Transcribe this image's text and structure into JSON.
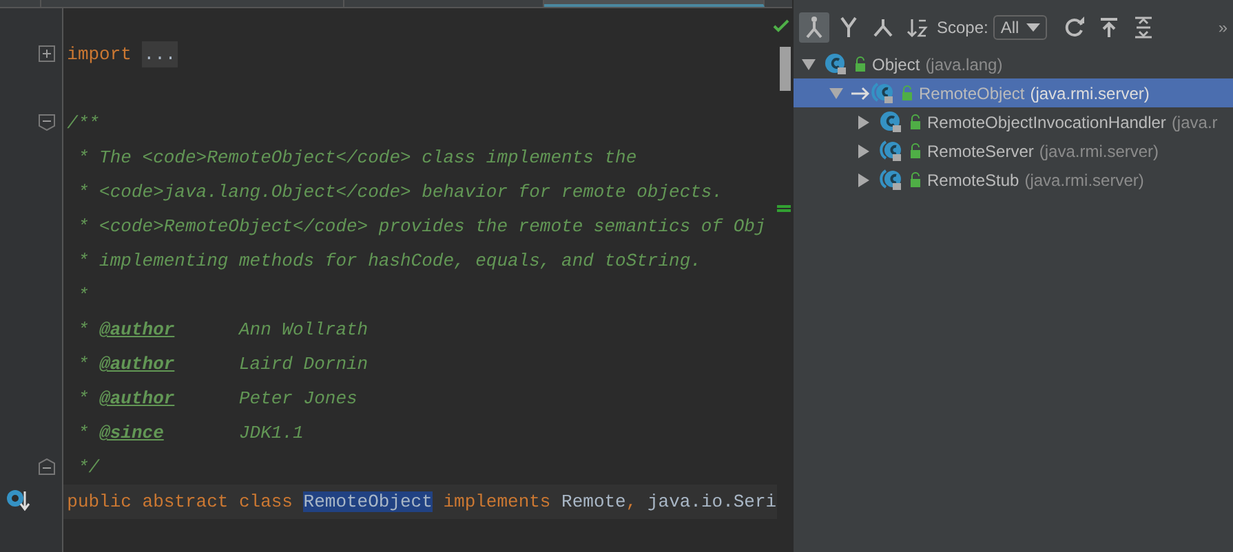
{
  "editor": {
    "lines": [
      {
        "fold_collapsed": true,
        "tokens": [
          {
            "kind": "keyword",
            "text": "import"
          },
          {
            "kind": "folded",
            "text": "..."
          }
        ]
      },
      {
        "kind": "blank"
      },
      {
        "fold_start": true,
        "tokens": [
          {
            "kind": "comment",
            "text": "/**"
          }
        ]
      },
      {
        "tokens": [
          {
            "kind": "comment",
            "text": " * The <code>RemoteObject</code> class implements the"
          }
        ]
      },
      {
        "tokens": [
          {
            "kind": "comment",
            "text": " * <code>java.lang.Object</code> behavior for remote objects."
          }
        ]
      },
      {
        "tokens": [
          {
            "kind": "comment",
            "text": " * <code>RemoteObject</code> provides the remote semantics of Obj"
          }
        ]
      },
      {
        "tokens": [
          {
            "kind": "comment",
            "text": " * implementing methods for hashCode, equals, and toString."
          }
        ]
      },
      {
        "tokens": [
          {
            "kind": "comment",
            "text": " *"
          }
        ]
      },
      {
        "tokens": [
          {
            "kind": "comment",
            "text": " * "
          },
          {
            "kind": "doctag",
            "text": "@author"
          },
          {
            "kind": "comment",
            "text": "      Ann Wollrath"
          }
        ]
      },
      {
        "tokens": [
          {
            "kind": "comment",
            "text": " * "
          },
          {
            "kind": "doctag",
            "text": "@author"
          },
          {
            "kind": "comment",
            "text": "      Laird Dornin"
          }
        ]
      },
      {
        "tokens": [
          {
            "kind": "comment",
            "text": " * "
          },
          {
            "kind": "doctag",
            "text": "@author"
          },
          {
            "kind": "comment",
            "text": "      Peter Jones"
          }
        ]
      },
      {
        "tokens": [
          {
            "kind": "comment",
            "text": " * "
          },
          {
            "kind": "doctag",
            "text": "@since"
          },
          {
            "kind": "comment",
            "text": "       JDK1.1"
          }
        ]
      },
      {
        "fold_end": true,
        "tokens": [
          {
            "kind": "comment",
            "text": " */"
          }
        ]
      },
      {
        "current": true,
        "marker": true,
        "tokens": [
          {
            "kind": "keyword",
            "text": "public abstract class "
          },
          {
            "kind": "selected",
            "text": "RemoteObject"
          },
          {
            "kind": "keyword",
            "text": " implements "
          },
          {
            "kind": "plain",
            "text": "Remote"
          },
          {
            "kind": "keyword",
            "text": ","
          },
          {
            "kind": "plain",
            "text": " java.io.Seri"
          }
        ]
      }
    ]
  },
  "hierarchy": {
    "toolbar": {
      "scope_label": "Scope:",
      "scope_value": "All",
      "overflow": "»"
    },
    "tree": [
      {
        "name": "Object",
        "package": "(java.lang)",
        "kind": "class",
        "expanded": true,
        "selected": false,
        "children": [
          {
            "name": "RemoteObject",
            "package": "(java.rmi.server)",
            "kind": "abstract",
            "expanded": true,
            "selected": true,
            "children": [
              {
                "name": "RemoteObjectInvocationHandler",
                "package": "(java.r",
                "kind": "class",
                "expanded": false,
                "selected": false
              },
              {
                "name": "RemoteServer",
                "package": "(java.rmi.server)",
                "kind": "abstract",
                "expanded": false,
                "selected": false
              },
              {
                "name": "RemoteStub",
                "package": "(java.rmi.server)",
                "kind": "abstract",
                "expanded": false,
                "selected": false
              }
            ]
          }
        ]
      }
    ]
  }
}
